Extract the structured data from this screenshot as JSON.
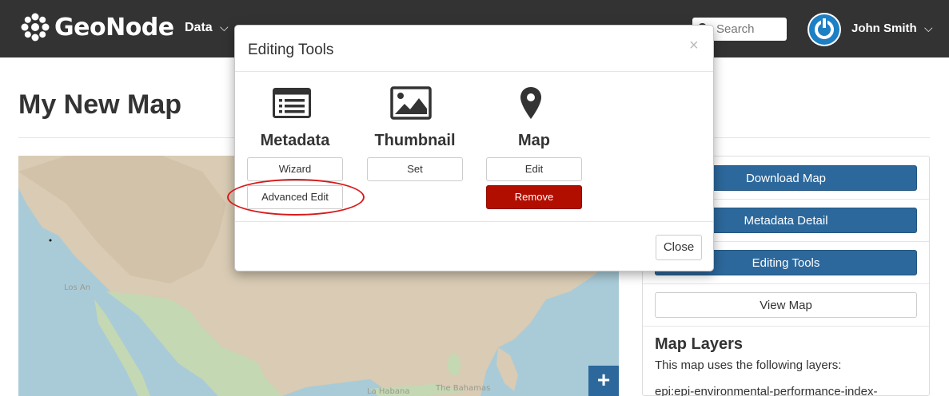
{
  "header": {
    "brand": "GeoNode",
    "nav_data": "Data",
    "search_placeholder": "Search",
    "user_name": "John Smith"
  },
  "page": {
    "title": "My New Map"
  },
  "map": {
    "labels": {
      "los_angeles": "Los An",
      "la_habana": "La Habana",
      "the_bahamas": "The Bahamas"
    },
    "zoom_in": "+"
  },
  "sidebar": {
    "buttons": {
      "download": "Download Map",
      "metadata_detail": "Metadata Detail",
      "editing_tools": "Editing Tools",
      "view_map": "View Map"
    },
    "layers": {
      "title": "Map Layers",
      "description": "This map uses the following layers:",
      "items": [
        "epi:epi-environmental-performance-index-"
      ]
    }
  },
  "modal": {
    "title": "Editing Tools",
    "close_x": "×",
    "sections": {
      "metadata": {
        "title": "Metadata",
        "wizard": "Wizard",
        "advanced": "Advanced Edit"
      },
      "thumbnail": {
        "title": "Thumbnail",
        "set": "Set"
      },
      "map": {
        "title": "Map",
        "edit": "Edit",
        "remove": "Remove"
      }
    },
    "close_button": "Close"
  },
  "colors": {
    "navbar": "#333333",
    "primary": "#2c689c",
    "danger": "#b10e00",
    "highlight": "#d81a1a"
  }
}
